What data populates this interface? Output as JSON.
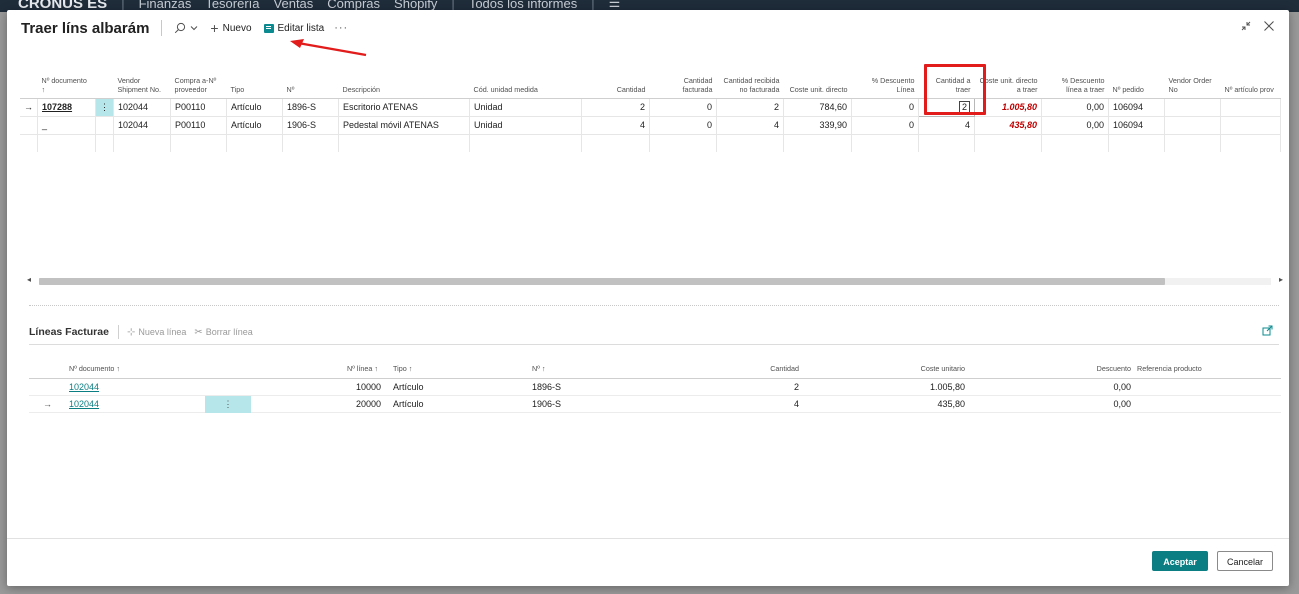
{
  "appbar": {
    "brand": "CRONUS ES",
    "menus": [
      "Finanzas",
      "Tesorería",
      "Ventas",
      "Compras",
      "Shopify"
    ],
    "all_reports": "Todos los informes"
  },
  "dialog": {
    "title": "Traer líns albarám",
    "new_label": "Nuevo",
    "edit_list_label": "Editar lista",
    "more_label": "···"
  },
  "upper_grid": {
    "columns": [
      "Nº documento ↑",
      "",
      "Vendor Shipment No.",
      "Compra a-Nº proveedor",
      "Tipo",
      "Nº",
      "Descripción",
      "Cód. unidad medida",
      "Cantidad",
      "Cantidad facturada",
      "Cantidad recibida no facturada",
      "Coste unit. directo",
      "% Descuento Línea",
      "Cantidad a traer",
      "Coste unit. directo a traer",
      "% Descuento línea a traer",
      "Nº pedido",
      "Vendor Order No",
      "Nº artículo prov"
    ],
    "rows": [
      {
        "marker": "→",
        "doc": "107288",
        "dots": "⋮",
        "vendor_shipment": "102044",
        "vendor_no": "P00110",
        "type": "Artículo",
        "no": "1896-S",
        "description": "Escritorio ATENAS",
        "uom": "Unidad",
        "qty": "2",
        "qty_invoiced": "0",
        "qty_rcd_not_inv": "2",
        "unit_cost": "784,60",
        "line_disc": "0",
        "qty_to_get": "2",
        "unit_cost_to_get": "1.005,80",
        "line_disc_to_get": "0,00",
        "order_no": "106094",
        "vendor_order_no": "",
        "vendor_item_no": ""
      },
      {
        "marker": "",
        "doc": "_",
        "dots": "",
        "vendor_shipment": "102044",
        "vendor_no": "P00110",
        "type": "Artículo",
        "no": "1906-S",
        "description": "Pedestal móvil ATENAS",
        "uom": "Unidad",
        "qty": "4",
        "qty_invoiced": "0",
        "qty_rcd_not_inv": "4",
        "unit_cost": "339,90",
        "line_disc": "0",
        "qty_to_get": "4",
        "unit_cost_to_get": "435,80",
        "line_disc_to_get": "0,00",
        "order_no": "106094",
        "vendor_order_no": "",
        "vendor_item_no": ""
      }
    ]
  },
  "lower": {
    "title": "Líneas Facturae",
    "new_line": "Nueva línea",
    "delete_line": "Borrar línea",
    "columns": {
      "doc": "Nº documento ↑",
      "line_no": "Nº línea ↑",
      "type": "Tipo ↑",
      "no": "Nº ↑",
      "qty": "Cantidad",
      "unit_cost": "Coste unitario",
      "discount": "Descuento",
      "product_ref": "Referencia producto"
    },
    "rows": [
      {
        "marker": "",
        "doc": "102044",
        "line_no": "10000",
        "type": "Artículo",
        "no": "1896-S",
        "qty": "2",
        "unit_cost": "1.005,80",
        "discount": "0,00"
      },
      {
        "marker": "→",
        "doc": "102044",
        "line_no": "20000",
        "type": "Artículo",
        "no": "1906-S",
        "qty": "4",
        "unit_cost": "435,80",
        "discount": "0,00"
      }
    ]
  },
  "footer": {
    "accept": "Aceptar",
    "cancel": "Cancelar"
  },
  "colors": {
    "accent": "#0b7e83",
    "highlight_red": "#e21b1b",
    "red_value": "#c00000"
  }
}
